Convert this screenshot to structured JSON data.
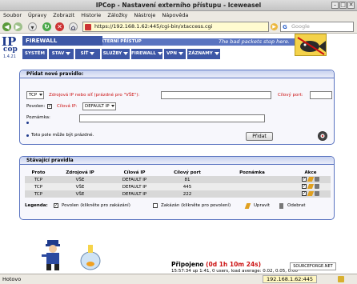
{
  "window": {
    "title": "IPCop - Nastavení externího přístupu - Iceweasel",
    "min": "–",
    "max": "□",
    "close": "✕"
  },
  "menu": [
    "Soubor",
    "Úpravy",
    "Zobrazit",
    "Historie",
    "Záložky",
    "Nástroje",
    "Nápověda"
  ],
  "nav": {
    "url": "https://192.168.1.62:445/cgi-bin/xtaccess.cgi",
    "search_placeholder": "Google"
  },
  "header": {
    "logo_ip": "IP",
    "logo_cop": "cop",
    "version": "1.4.21",
    "section": "FIREWALL",
    "subsection": "EXTERNÍ PŘÍSTUP",
    "slogan": "The bad packets stop here."
  },
  "tabs": [
    "SYSTÉM",
    "STAV",
    "SÍŤ",
    "SLUŽBY",
    "FIREWALL",
    "VPN",
    "ZÁZNAMY"
  ],
  "add_rule": {
    "title": "Přidat nové pravidlo:",
    "protocol": "TCP",
    "source_label": "Zdrojová IP nebo síť (prázdné pro \"VŠE\"):",
    "source_value": "",
    "port_label": "Cílový port:",
    "port_value": "",
    "enabled_label": "Povolen:",
    "dest_ip_label": "Cílová IP:",
    "dest_ip_value": "DEFAULT IP",
    "note_label": "Poznámka:",
    "note_value": "",
    "optional_hint": "Toto pole může být prázdné.",
    "add_button": "Přidat"
  },
  "rules": {
    "title": "Stávající pravidla",
    "headers": [
      "Proto",
      "Zdrojová IP",
      "Cílová IP",
      "Cílový port",
      "Poznámka",
      "Akce"
    ],
    "rows": [
      [
        "TCP",
        "VŠE",
        "DEFAULT IP",
        "81",
        ""
      ],
      [
        "TCP",
        "VŠE",
        "DEFAULT IP",
        "445",
        ""
      ],
      [
        "TCP",
        "VŠE",
        "DEFAULT IP",
        "222",
        ""
      ]
    ],
    "legend": {
      "label": "Legenda:",
      "enabled": "Povolen (klikněte pro zakázání)",
      "disabled": "Zakázán (klikněte pro povolení)",
      "edit": "Upravit",
      "delete": "Odebrat"
    }
  },
  "footer": {
    "connected": "Připojeno",
    "uptime": "(0d 1h 10m 24s)",
    "load": "15:57:34 up 1:41, 0 users, load average: 0.02, 0.05, 0.00",
    "sf_badge": "SOURCEFORGE.NET"
  },
  "statusbar": {
    "left": "Hotovo",
    "host": "192.168.1.62:445"
  }
}
